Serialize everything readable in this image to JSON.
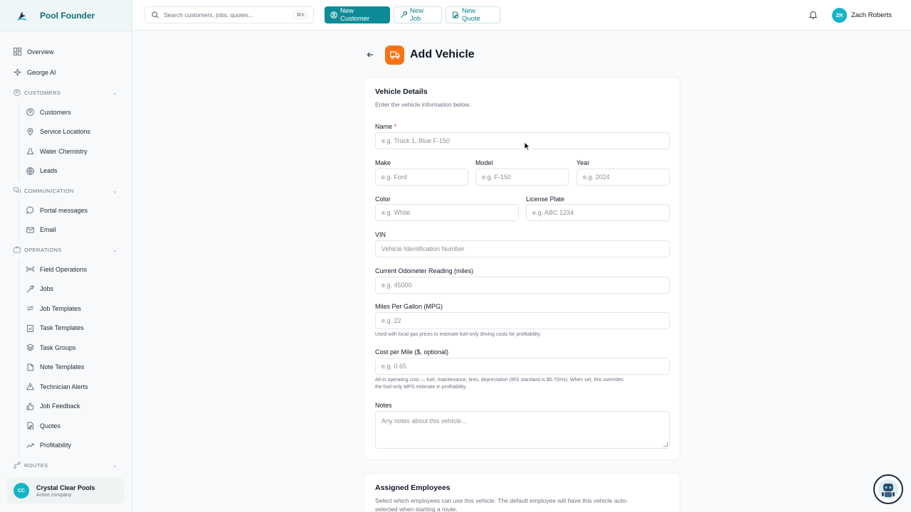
{
  "brand": {
    "name": "Pool Founder",
    "logo_icon": "pool-founder-logo-icon"
  },
  "sidebar": {
    "top_items": [
      {
        "label": "Overview",
        "icon": "grid-icon"
      },
      {
        "label": "George AI",
        "icon": "sparkle-icon"
      }
    ],
    "sections": [
      {
        "label": "CUSTOMERS",
        "items": [
          "Customers",
          "Service Locations",
          "Water Chemistry",
          "Leads"
        ]
      },
      {
        "label": "COMMUNICATION",
        "items": [
          "Portal messages",
          "Email"
        ]
      },
      {
        "label": "OPERATIONS",
        "items": [
          "Field Operations",
          "Jobs",
          "Job Templates",
          "Task Templates",
          "Task Groups",
          "Note Templates",
          "Technician Alerts",
          "Job Feedback",
          "Quotes",
          "Profitability"
        ]
      },
      {
        "label": "ROUTES",
        "items": []
      }
    ]
  },
  "company": {
    "initials": "CC",
    "name": "Crystal Clear Pools",
    "status": "Active company"
  },
  "topbar": {
    "search_placeholder": "Search customers, jobs, quotes...",
    "search_shortcut": "⌘K",
    "new_customer": "New Customer",
    "new_job": "New Job",
    "new_quote": "New Quote",
    "user_initials": "ZR",
    "user_name": "Zach Roberts"
  },
  "page": {
    "title": "Add Vehicle"
  },
  "vehicle_details": {
    "title": "Vehicle Details",
    "subtitle": "Enter the vehicle information below.",
    "name_label": "Name",
    "name_required": "*",
    "name_placeholder": "e.g. Truck 1, Blue F-150",
    "make_label": "Make",
    "make_placeholder": "e.g. Ford",
    "model_label": "Model",
    "model_placeholder": "e.g. F-150",
    "year_label": "Year",
    "year_placeholder": "e.g. 2024",
    "color_label": "Color",
    "color_placeholder": "e.g. White",
    "plate_label": "License Plate",
    "plate_placeholder": "e.g. ABC 1234",
    "vin_label": "VIN",
    "vin_placeholder": "Vehicle Identification Number",
    "odometer_label": "Current Odometer Reading (miles)",
    "odometer_placeholder": "e.g. 45000",
    "mpg_label": "Miles Per Gallon (MPG)",
    "mpg_placeholder": "e.g. 22",
    "mpg_hint": "Used with local gas prices to estimate fuel-only driving costs for profitability.",
    "cpm_label": "Cost per Mile ($, optional)",
    "cpm_placeholder": "e.g. 0.65",
    "cpm_hint_1": "All-in operating cost — fuel, maintenance, tires, depreciation (IRS standard is $0.70/mi). When set, this overrides",
    "cpm_hint_2": "the fuel-only MPG estimate in profitability.",
    "notes_label": "Notes",
    "notes_placeholder": "Any notes about this vehicle..."
  },
  "assigned_employees": {
    "title": "Assigned Employees",
    "desc_1": "Select which employees can use this vehicle. The default employee will have this vehicle auto-",
    "desc_2": "selected when starting a route."
  },
  "colors": {
    "accent": "#0f8b97",
    "title_icon_bg": "#f97316",
    "avatar": "#12b5c6"
  }
}
